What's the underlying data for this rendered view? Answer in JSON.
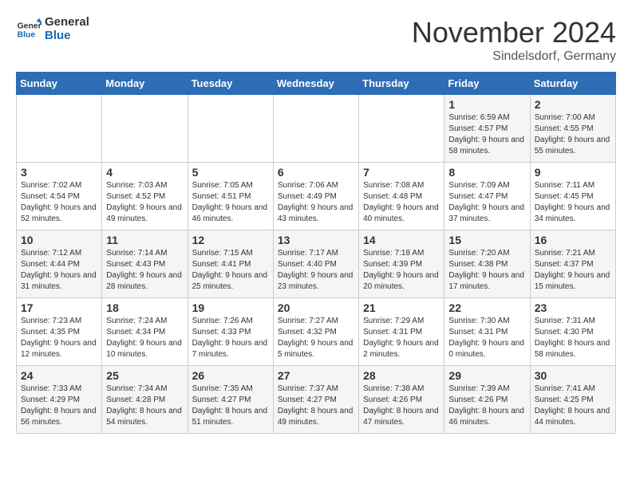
{
  "logo": {
    "line1": "General",
    "line2": "Blue"
  },
  "title": "November 2024",
  "subtitle": "Sindelsdorf, Germany",
  "days_of_week": [
    "Sunday",
    "Monday",
    "Tuesday",
    "Wednesday",
    "Thursday",
    "Friday",
    "Saturday"
  ],
  "weeks": [
    [
      {
        "day": "",
        "info": ""
      },
      {
        "day": "",
        "info": ""
      },
      {
        "day": "",
        "info": ""
      },
      {
        "day": "",
        "info": ""
      },
      {
        "day": "",
        "info": ""
      },
      {
        "day": "1",
        "info": "Sunrise: 6:59 AM\nSunset: 4:57 PM\nDaylight: 9 hours and 58 minutes."
      },
      {
        "day": "2",
        "info": "Sunrise: 7:00 AM\nSunset: 4:55 PM\nDaylight: 9 hours and 55 minutes."
      }
    ],
    [
      {
        "day": "3",
        "info": "Sunrise: 7:02 AM\nSunset: 4:54 PM\nDaylight: 9 hours and 52 minutes."
      },
      {
        "day": "4",
        "info": "Sunrise: 7:03 AM\nSunset: 4:52 PM\nDaylight: 9 hours and 49 minutes."
      },
      {
        "day": "5",
        "info": "Sunrise: 7:05 AM\nSunset: 4:51 PM\nDaylight: 9 hours and 46 minutes."
      },
      {
        "day": "6",
        "info": "Sunrise: 7:06 AM\nSunset: 4:49 PM\nDaylight: 9 hours and 43 minutes."
      },
      {
        "day": "7",
        "info": "Sunrise: 7:08 AM\nSunset: 4:48 PM\nDaylight: 9 hours and 40 minutes."
      },
      {
        "day": "8",
        "info": "Sunrise: 7:09 AM\nSunset: 4:47 PM\nDaylight: 9 hours and 37 minutes."
      },
      {
        "day": "9",
        "info": "Sunrise: 7:11 AM\nSunset: 4:45 PM\nDaylight: 9 hours and 34 minutes."
      }
    ],
    [
      {
        "day": "10",
        "info": "Sunrise: 7:12 AM\nSunset: 4:44 PM\nDaylight: 9 hours and 31 minutes."
      },
      {
        "day": "11",
        "info": "Sunrise: 7:14 AM\nSunset: 4:43 PM\nDaylight: 9 hours and 28 minutes."
      },
      {
        "day": "12",
        "info": "Sunrise: 7:15 AM\nSunset: 4:41 PM\nDaylight: 9 hours and 25 minutes."
      },
      {
        "day": "13",
        "info": "Sunrise: 7:17 AM\nSunset: 4:40 PM\nDaylight: 9 hours and 23 minutes."
      },
      {
        "day": "14",
        "info": "Sunrise: 7:18 AM\nSunset: 4:39 PM\nDaylight: 9 hours and 20 minutes."
      },
      {
        "day": "15",
        "info": "Sunrise: 7:20 AM\nSunset: 4:38 PM\nDaylight: 9 hours and 17 minutes."
      },
      {
        "day": "16",
        "info": "Sunrise: 7:21 AM\nSunset: 4:37 PM\nDaylight: 9 hours and 15 minutes."
      }
    ],
    [
      {
        "day": "17",
        "info": "Sunrise: 7:23 AM\nSunset: 4:35 PM\nDaylight: 9 hours and 12 minutes."
      },
      {
        "day": "18",
        "info": "Sunrise: 7:24 AM\nSunset: 4:34 PM\nDaylight: 9 hours and 10 minutes."
      },
      {
        "day": "19",
        "info": "Sunrise: 7:26 AM\nSunset: 4:33 PM\nDaylight: 9 hours and 7 minutes."
      },
      {
        "day": "20",
        "info": "Sunrise: 7:27 AM\nSunset: 4:32 PM\nDaylight: 9 hours and 5 minutes."
      },
      {
        "day": "21",
        "info": "Sunrise: 7:29 AM\nSunset: 4:31 PM\nDaylight: 9 hours and 2 minutes."
      },
      {
        "day": "22",
        "info": "Sunrise: 7:30 AM\nSunset: 4:31 PM\nDaylight: 9 hours and 0 minutes."
      },
      {
        "day": "23",
        "info": "Sunrise: 7:31 AM\nSunset: 4:30 PM\nDaylight: 8 hours and 58 minutes."
      }
    ],
    [
      {
        "day": "24",
        "info": "Sunrise: 7:33 AM\nSunset: 4:29 PM\nDaylight: 8 hours and 56 minutes."
      },
      {
        "day": "25",
        "info": "Sunrise: 7:34 AM\nSunset: 4:28 PM\nDaylight: 8 hours and 54 minutes."
      },
      {
        "day": "26",
        "info": "Sunrise: 7:35 AM\nSunset: 4:27 PM\nDaylight: 8 hours and 51 minutes."
      },
      {
        "day": "27",
        "info": "Sunrise: 7:37 AM\nSunset: 4:27 PM\nDaylight: 8 hours and 49 minutes."
      },
      {
        "day": "28",
        "info": "Sunrise: 7:38 AM\nSunset: 4:26 PM\nDaylight: 8 hours and 47 minutes."
      },
      {
        "day": "29",
        "info": "Sunrise: 7:39 AM\nSunset: 4:26 PM\nDaylight: 8 hours and 46 minutes."
      },
      {
        "day": "30",
        "info": "Sunrise: 7:41 AM\nSunset: 4:25 PM\nDaylight: 8 hours and 44 minutes."
      }
    ]
  ]
}
